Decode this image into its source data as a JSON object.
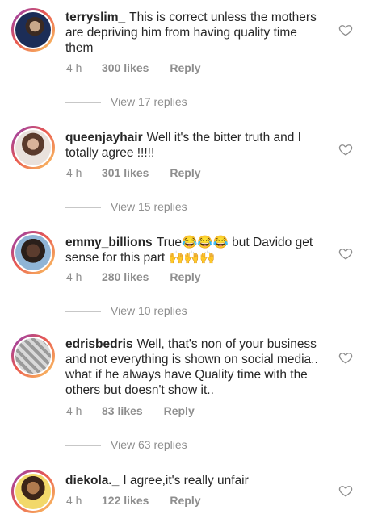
{
  "comments": [
    {
      "username": "terryslim_",
      "text": "This is correct unless the mothers are depriving him from having quality time them",
      "time": "4 h",
      "likes": "300 likes",
      "reply": "Reply",
      "view_replies": "View 17 replies"
    },
    {
      "username": "queenjayhair",
      "text": "Well it's the bitter truth and I totally agree !!!!!",
      "time": "4 h",
      "likes": "301 likes",
      "reply": "Reply",
      "view_replies": "View 15 replies"
    },
    {
      "username": "emmy_billions",
      "text": "True😂😂😂 but Davido get sense for this part 🙌🙌🙌",
      "time": "4 h",
      "likes": "280 likes",
      "reply": "Reply",
      "view_replies": "View 10 replies"
    },
    {
      "username": "edrisbedris",
      "text": "Well, that's non of your business and not everything is shown on social media.. what if he always have Quality time with the others but doesn't show it..",
      "time": "4 h",
      "likes": "83 likes",
      "reply": "Reply",
      "view_replies": "View 63 replies"
    },
    {
      "username": "diekola._",
      "text": "I agree,it's really unfair",
      "time": "4 h",
      "likes": "122 likes",
      "reply": "Reply"
    }
  ],
  "colors": {
    "text": "#262626",
    "muted": "#8e8e8e",
    "ring_gradient": [
      "#8a3ab9",
      "#e95950",
      "#fccc63"
    ]
  }
}
